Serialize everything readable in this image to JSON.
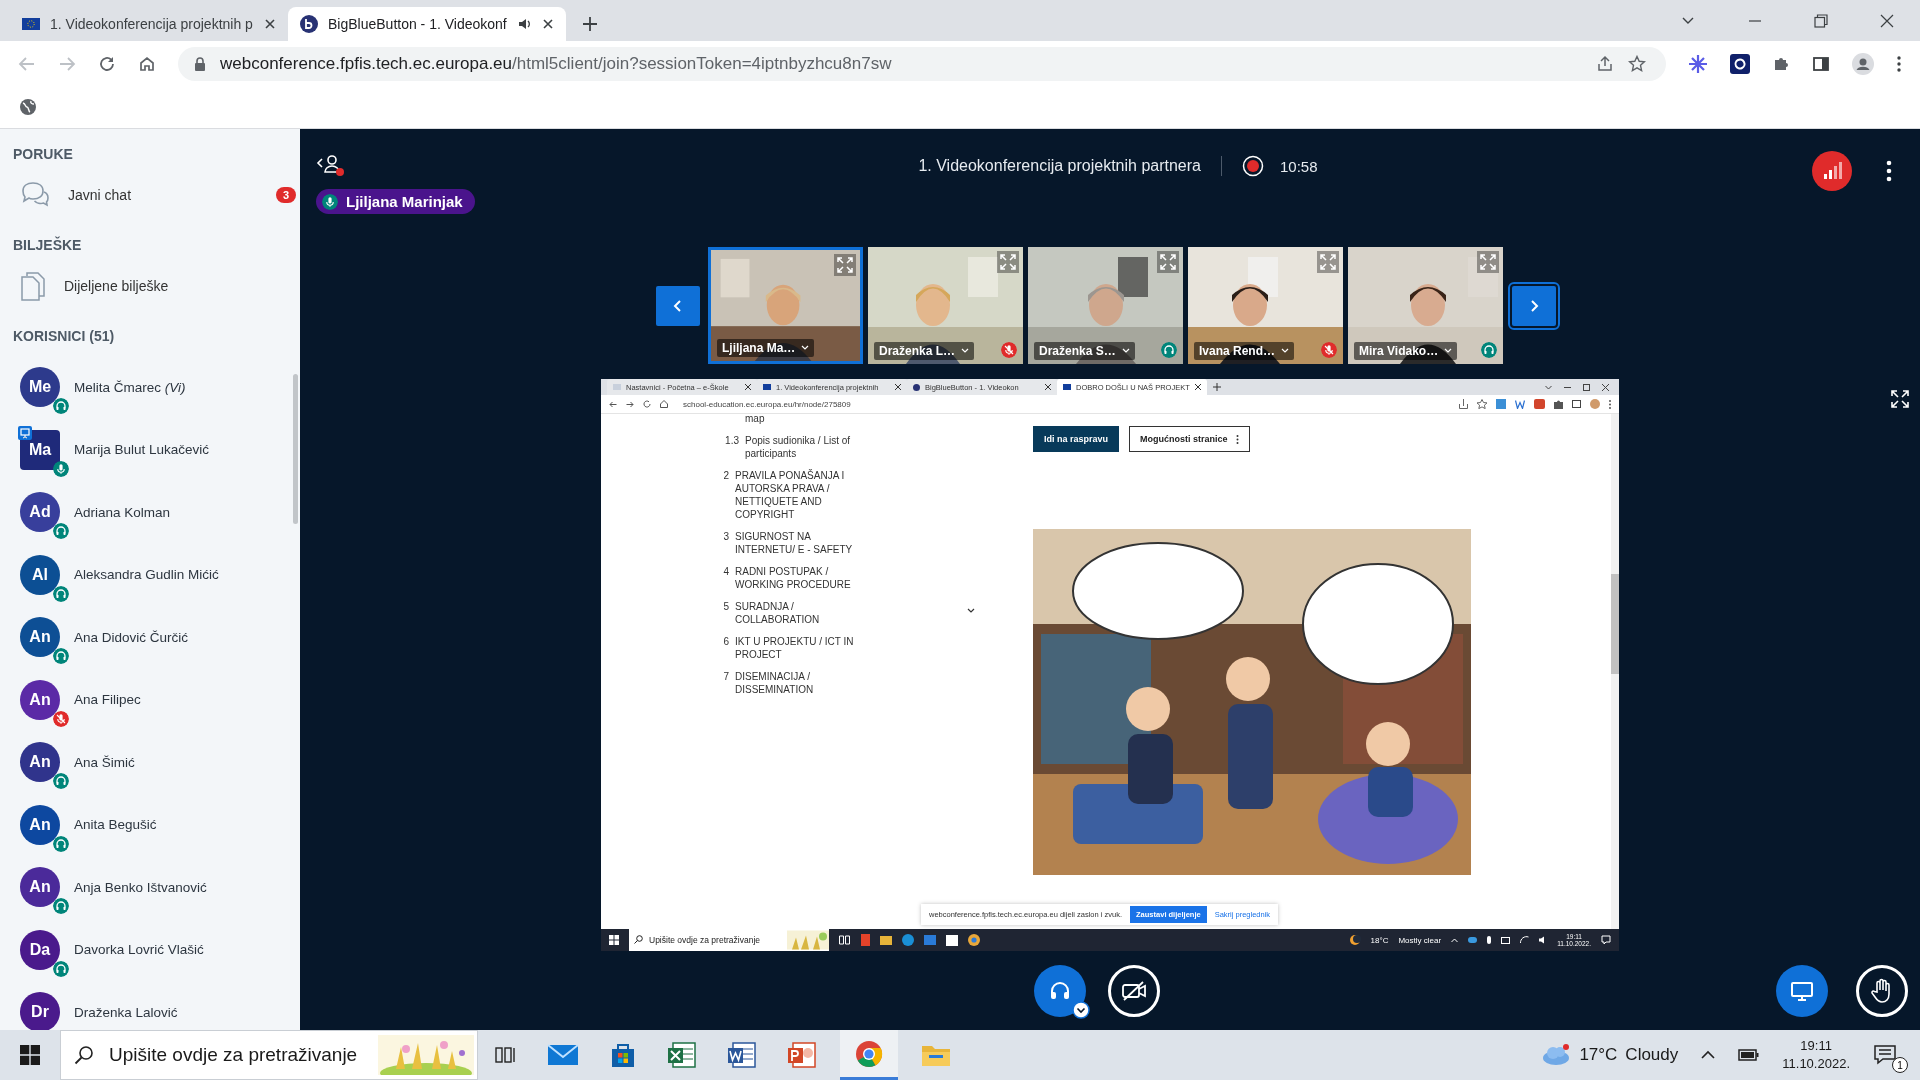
{
  "browser": {
    "tabs": [
      {
        "title": "1. Videokonferencija projektnih p",
        "selected": false,
        "audio": false
      },
      {
        "title": "BigBlueButton - 1. Videokonf",
        "selected": true,
        "audio": true
      }
    ],
    "url_host": "webconference.fpfis.tech.ec.europa.eu",
    "url_path": "/html5client/join?sessionToken=4iptnbyzhcu8n7sw"
  },
  "sidebar": {
    "messages_heading": "PORUKE",
    "chat_label": "Javni chat",
    "chat_badge": "3",
    "notes_heading": "BILJEŠKE",
    "notes_label": "Dijeljene bilješke",
    "users_heading": "KORISNICI (51)",
    "users": [
      {
        "initials": "Me",
        "name": "Melita Čmarec *(Vi)*",
        "color": "#2d3a8c",
        "kind": "listen",
        "presenter": false
      },
      {
        "initials": "Ma",
        "name": "Marija Bulut Lukačević",
        "color": "#1f2a7a",
        "kind": "mic",
        "presenter": true
      },
      {
        "initials": "Ad",
        "name": "Adriana Kolman",
        "color": "#383f9c",
        "kind": "listen",
        "presenter": false
      },
      {
        "initials": "Al",
        "name": "Aleksandra Gudlin Mićić",
        "color": "#0c4f94",
        "kind": "listen",
        "presenter": false
      },
      {
        "initials": "An",
        "name": "Ana Didović Čurčić",
        "color": "#0d4f95",
        "kind": "listen",
        "presenter": false
      },
      {
        "initials": "An",
        "name": "Ana Filipec",
        "color": "#5b2aa6",
        "kind": "muted",
        "presenter": false
      },
      {
        "initials": "An",
        "name": "Ana Šimić",
        "color": "#30348c",
        "kind": "listen",
        "presenter": false
      },
      {
        "initials": "An",
        "name": "Anita Begušić",
        "color": "#0d48a0",
        "kind": "listen",
        "presenter": false
      },
      {
        "initials": "An",
        "name": "Anja Benko Ištvanović",
        "color": "#4b2a9a",
        "kind": "listen",
        "presenter": false
      },
      {
        "initials": "Da",
        "name": "Davorka Lovrić Vlašić",
        "color": "#4a1a8c",
        "kind": "listen",
        "presenter": false
      },
      {
        "initials": "Dr",
        "name": "Draženka Lalović",
        "color": "#4a1a8c",
        "kind": "none",
        "presenter": false
      }
    ]
  },
  "meeting": {
    "title": "1. Videokonferencija projektnih partnera",
    "recording": true,
    "time": "10:58",
    "talker": "Ljiljana Marinjak"
  },
  "videos": [
    {
      "name": "Ljiljana Ma…",
      "kind": "none",
      "selected": true
    },
    {
      "name": "Draženka L…",
      "kind": "muted",
      "selected": false
    },
    {
      "name": "Draženka S…",
      "kind": "listen",
      "selected": false
    },
    {
      "name": "Ivana Rend…",
      "kind": "muted",
      "selected": false
    },
    {
      "name": "Mira Vidako…",
      "kind": "listen",
      "selected": false
    }
  ],
  "shared": {
    "tabs": [
      {
        "title": "Nastavnici - Početna – e-Škole",
        "selected": false
      },
      {
        "title": "1. Videokonferencija projektnih",
        "selected": false
      },
      {
        "title": "BigBlueButton - 1. Videokon",
        "selected": false
      },
      {
        "title": "DOBRO DOŠLI U NAŠ PROJEKT",
        "selected": true
      }
    ],
    "url": "school-education.ec.europa.eu/hr/node/275809",
    "nav": [
      {
        "text": "map",
        "expandable": false
      },
      {
        "num": "1.3",
        "text": "Popis sudionika / List of participants",
        "expandable": false
      },
      {
        "num": "2",
        "text": "PRAVILA PONAŠANJA I AUTORSKA PRAVA / NETTIQUETE AND COPYRIGHT",
        "expandable": false
      },
      {
        "num": "3",
        "text": "SIGURNOST NA INTERNETU/ E - SAFETY",
        "expandable": false
      },
      {
        "num": "4",
        "text": "RADNI POSTUPAK / WORKING PROCEDURE",
        "expandable": false
      },
      {
        "num": "5",
        "text": "SURADNJA / COLLABORATION",
        "expandable": true
      },
      {
        "num": "6",
        "text": "IKT U PROJEKTU / ICT IN PROJECT",
        "expandable": false
      },
      {
        "num": "7",
        "text": "DISEMINACIJA / DISSEMINATION",
        "expandable": false
      }
    ],
    "primary_button": "Idi na raspravu",
    "options_button": "Mogućnosti stranice",
    "share_notice": "webconference.fpfis.tech.ec.europa.eu dijeli zaslon i zvuk.",
    "stop_button": "Zaustavi dijeljenje",
    "hide_button": "Sakrij preglednik",
    "taskbar": {
      "search_placeholder": "Upišite ovdje za pretraživanje",
      "weather": "18°C",
      "weather_text": "Mostly clear",
      "time": "19:11",
      "date": "11.10.2022."
    }
  },
  "taskbar": {
    "search_placeholder": "Upišite ovdje za pretraživanje",
    "weather": "17°C",
    "weather_text": "Cloudy",
    "time": "19:11",
    "date": "11.10.2022.",
    "notifications": "1"
  }
}
